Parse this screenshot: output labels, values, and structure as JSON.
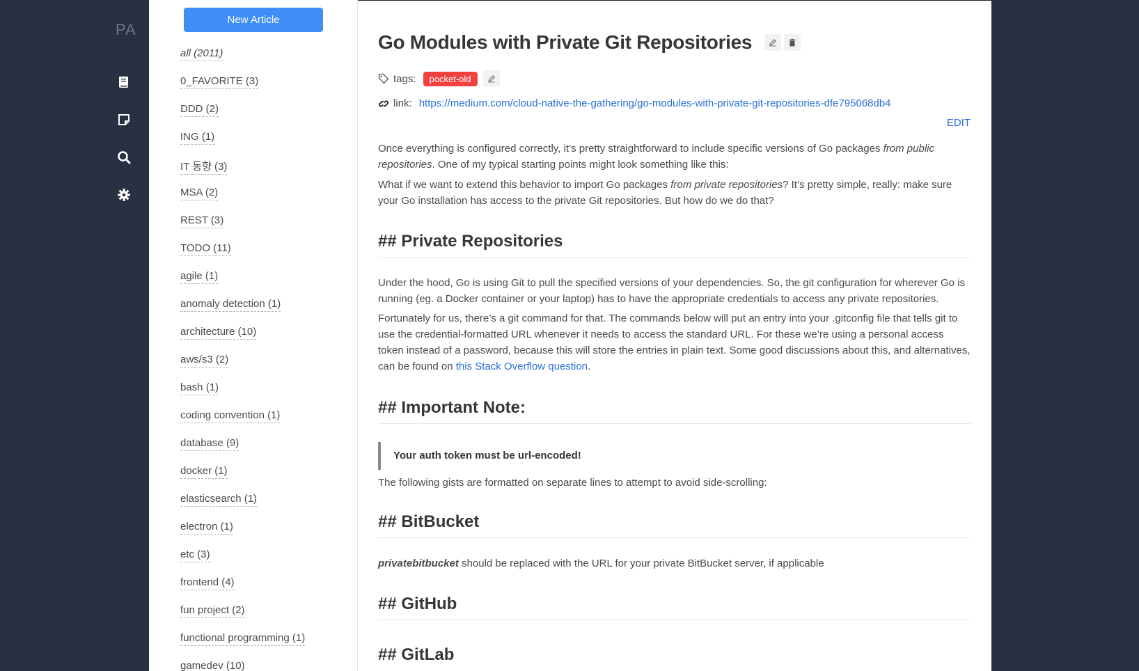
{
  "app": {
    "logo": "PA"
  },
  "rail": {
    "icons": [
      "book-icon",
      "note-icon",
      "search-icon",
      "gear-icon"
    ]
  },
  "sidebar": {
    "new_button": "New Article",
    "tags": [
      "all (2011)",
      "0_FAVORITE (3)",
      "DDD (2)",
      "ING (1)",
      "IT 동향 (3)",
      "MSA (2)",
      "REST (3)",
      "TODO (11)",
      "agile (1)",
      "anomaly detection (1)",
      "architecture (10)",
      "aws/s3 (2)",
      "bash (1)",
      "coding convention (1)",
      "database (9)",
      "docker (1)",
      "elasticsearch (1)",
      "electron (1)",
      "etc (3)",
      "frontend (4)",
      "fun project (2)",
      "functional programming (1)",
      "gamedev (10)"
    ]
  },
  "article": {
    "title": "Go Modules with Private Git Repositories",
    "tags_label": "tags:",
    "tag": "pocket-old",
    "link_label": "link:",
    "link": "https://medium.com/cloud-native-the-gathering/go-modules-with-private-git-repositories-dfe795068db4",
    "edit_label": "EDIT",
    "p1_a": "Once everything is configured correctly, it’s pretty straightforward to include specific versions of Go packages ",
    "p1_em": "from public repositories",
    "p1_b": ". One of my typical starting points might look something like this:",
    "p2_a": "What if we want to extend this behavior to import Go packages ",
    "p2_em": "from private repositories",
    "p2_b": "? It’s pretty simple, really: make sure your Go installation has access to the private Git repositories. But how do we do that?",
    "h_private": "## Private Repositories",
    "p3": "Under the hood, Go is using Git to pull the specified versions of your dependencies. So, the git configuration for wherever Go is running (eg. a Docker container or your laptop) has to have the appropriate credentials to access any private repositories.",
    "p4_a": "Fortunately for us, there’s a git command for that. The commands below will put an entry into your .gitconfig file that tells git to use the credential-formatted URL whenever it needs to access the standard URL. For these we’re using a personal access token instead of a password, because this will store the entries in plain text. Some good discussions about this, and alternatives, can be found on ",
    "p4_link": "this Stack Overflow question",
    "p4_b": ".",
    "h_note": "## Important Note:",
    "quote": "Your auth token must be url-encoded!",
    "p5": "The following gists are formatted on separate lines to attempt to avoid side-scrolling:",
    "h_bitbucket": "## BitBucket",
    "p6_em": "privatebitbucket",
    "p6_b": " should be replaced with the URL for your private BitBucket server, if applicable",
    "h_github": "## GitHub",
    "h_gitlab": "## GitLab"
  },
  "colors": {
    "rail_bg": "#283142",
    "accent": "#3f8ef5",
    "tag_badge": "#f14040",
    "link": "#2a6fd6"
  }
}
